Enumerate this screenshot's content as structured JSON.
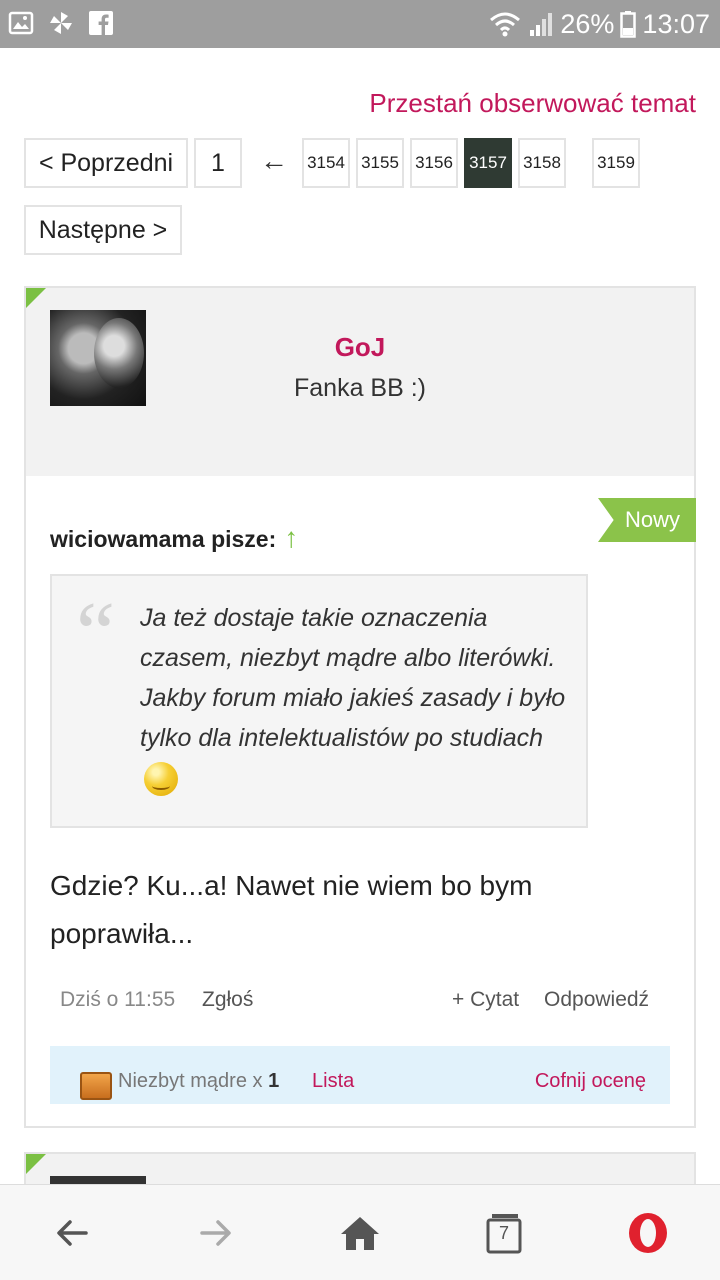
{
  "status_bar": {
    "battery": "26%",
    "time": "13:07",
    "left_icons": [
      "gallery-icon",
      "pinwheel-icon",
      "facebook-icon"
    ],
    "right_icons": [
      "wifi-icon",
      "signal-icon",
      "battery-icon"
    ]
  },
  "header": {
    "unwatch_label": "Przestań obserwować temat"
  },
  "pagination": {
    "prev_label": "< Poprzedni",
    "first_page": "1",
    "jump_arrow": "←",
    "pages": [
      "3154",
      "3155",
      "3156",
      "3157",
      "3158",
      "3159"
    ],
    "active_page": "3157",
    "next_label": "Następne >"
  },
  "post": {
    "author": "GoJ",
    "author_title": "Fanka BB :)",
    "badge": "Nowy",
    "quote_author": "wiciowamama pisze:",
    "quote_text": "Ja też dostaje takie oznaczenia czasem, niezbyt mądre albo literówki. Jakby forum miało jakieś zasady i było tylko dla intelektualistów po studiach",
    "body": "Gdzie? Ku...a! Nawet nie wiem bo bym poprawiła...",
    "date": "Dziś o 11:55",
    "report_label": "Zgłoś",
    "quote_label": "+ Cytat",
    "reply_label": "Odpowiedź",
    "rating": {
      "label": "Niezbyt mądre x",
      "count": "1",
      "list_label": "Lista",
      "undo_label": "Cofnij ocenę"
    }
  },
  "navbar": {
    "tabs_count": "7",
    "buttons": [
      "back-icon",
      "forward-icon",
      "home-icon",
      "tabs-icon",
      "opera-icon"
    ]
  },
  "colors": {
    "accent": "#c2185b",
    "badge_green": "#8bc34a",
    "active_page": "#2f3a33",
    "rating_bg": "#e1f2fb"
  }
}
